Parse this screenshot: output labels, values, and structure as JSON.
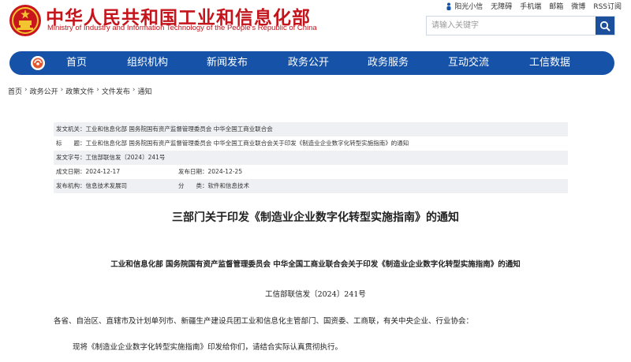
{
  "header": {
    "title": "中华人民共和国工业和信息化部",
    "subtitle": "Ministry of Industry and Information Technology of the People's Republic of China",
    "top_links": [
      "阳光小信",
      "无障碍",
      "手机端",
      "邮箱",
      "微博",
      "RSS订阅"
    ],
    "search_placeholder": "请输入关键字",
    "brand_color": "#c4151c"
  },
  "nav": {
    "color": "#1552a8",
    "items": [
      "首页",
      "组织机构",
      "新闻发布",
      "政务公开",
      "政务服务",
      "互动交流",
      "工信数据"
    ]
  },
  "breadcrumb": [
    "首页",
    "政务公开",
    "政策文件",
    "文件发布",
    "通知"
  ],
  "info": {
    "issuer": "发文机关：工业和信息化部 国务院国有资产监督管理委员会 中华全国工商业联合会",
    "title": "标　　题：工业和信息化部 国务院国有资产监督管理委员会 中华全国工商业联合会关于印发《制造业企业数字化转型实施指南》的通知",
    "doc_no": "发文字号：工信部联信发〔2024〕241号",
    "date_created": "成文日期：2024-12-17",
    "date_published": "发布日期：2024-12-25",
    "agency": "发布机构：信息技术发展司",
    "category": "分　　类：软件和信息技术"
  },
  "article": {
    "title": "三部门关于印发《制造业企业数字化转型实施指南》的通知",
    "issuers": "工业和信息化部 国务院国有资产监督管理委员会 中华全国工商业联合会关于印发《制造业企业数字化转型实施指南》的通知",
    "doc_number": "工信部联信发〔2024〕241号",
    "recipients": "各省、自治区、直辖市及计划单列市、新疆生产建设兵团工业和信息化主管部门、国资委、工商联，有关中央企业、行业协会：",
    "body_first": "现将《制造业企业数字化转型实施指南》印发给你们，请结合实际认真贯彻执行。"
  }
}
